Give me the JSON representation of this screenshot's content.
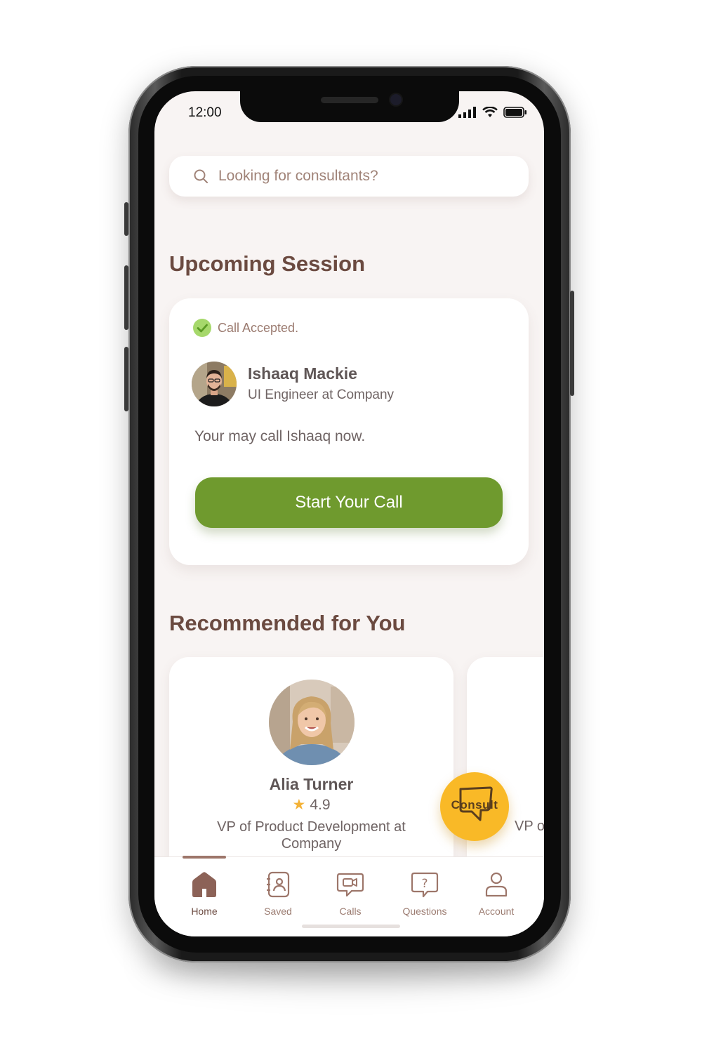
{
  "status_bar": {
    "time": "12:00"
  },
  "search": {
    "placeholder": "Looking for consultants?"
  },
  "upcoming": {
    "title": "Upcoming Session",
    "status": "Call Accepted.",
    "consultant_name": "Ishaaq Mackie",
    "consultant_role": "UI Engineer at Company",
    "message": "Your may call Ishaaq now.",
    "cta": "Start Your Call"
  },
  "recommended": {
    "title": "Recommended for You",
    "cards": [
      {
        "name": "Alia Turner",
        "rating": "4.9",
        "role": "VP of Product Development at Company"
      },
      {
        "role": "VP o"
      }
    ]
  },
  "fab": {
    "label": "Consult"
  },
  "tabs": [
    {
      "label": "Home",
      "icon": "home-icon",
      "active": true
    },
    {
      "label": "Saved",
      "icon": "contacts-book-icon"
    },
    {
      "label": "Calls",
      "icon": "video-chat-icon"
    },
    {
      "label": "Questions",
      "icon": "question-bubble-icon"
    },
    {
      "label": "Account",
      "icon": "user-icon"
    }
  ],
  "colors": {
    "brand": "#6b4a40",
    "accent_green": "#6f9a2e",
    "fab_yellow": "#f9b927",
    "background": "#f8f4f3"
  }
}
